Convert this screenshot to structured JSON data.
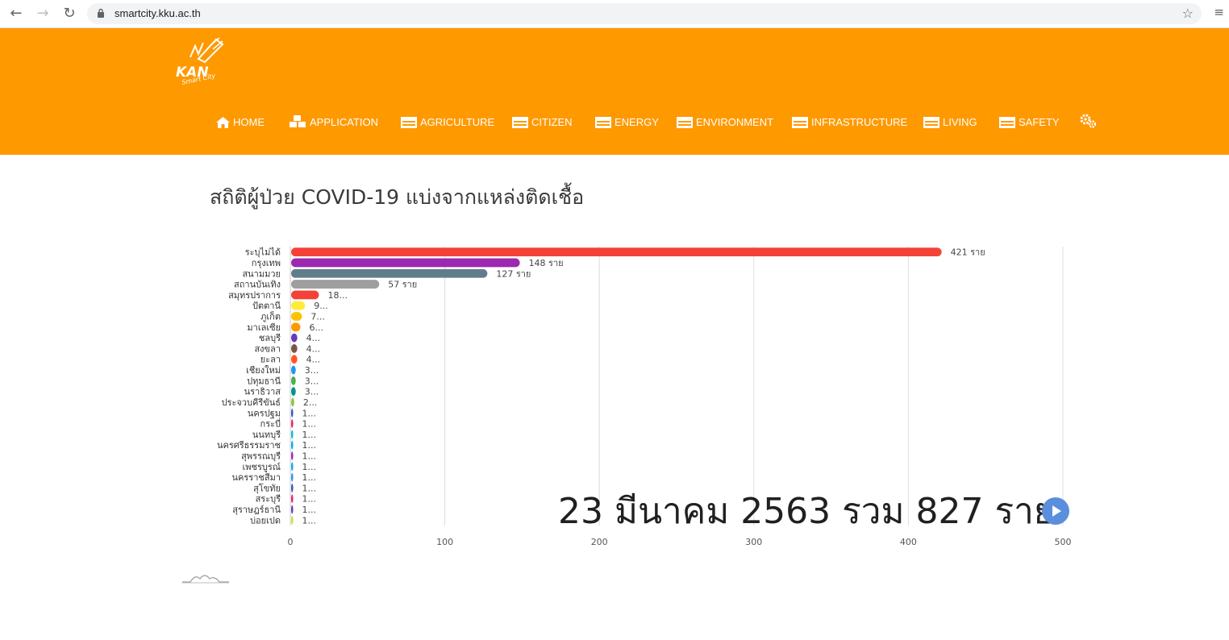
{
  "browser": {
    "url": "smartcity.kku.ac.th"
  },
  "site": {
    "logo_text": "KAN Smart City",
    "nav": [
      {
        "label": "HOME",
        "icon": "home-icon"
      },
      {
        "label": "APPLICATION",
        "icon": "cubes-icon"
      },
      {
        "label": "AGRICULTURE",
        "icon": "table-icon"
      },
      {
        "label": "CITIZEN",
        "icon": "table-icon"
      },
      {
        "label": "ENERGY",
        "icon": "table-icon"
      },
      {
        "label": "ENVIRONMENT",
        "icon": "table-icon"
      },
      {
        "label": "INFRASTRUCTURE",
        "icon": "table-icon"
      },
      {
        "label": "LIVING",
        "icon": "table-icon"
      },
      {
        "label": "SAFETY",
        "icon": "table-icon"
      },
      {
        "label": "",
        "icon": "cogs-icon"
      }
    ],
    "accent_color": "#ff9900"
  },
  "page": {
    "title": "สถิติผู้ป่วย COVID-19 แบ่งจากแหล่งติดเชื้อ"
  },
  "chart_data": {
    "type": "bar",
    "orientation": "horizontal",
    "title": "23 มีนาคม 2563 รวม 827 ราย",
    "xlim": [
      0,
      500
    ],
    "xticks": [
      "0",
      "100",
      "200",
      "300",
      "400",
      "500"
    ],
    "grid": true,
    "categories": [
      "ระบุไม่ได้",
      "กรุงเทพ",
      "สนามมวย",
      "สถานบันเทิง",
      "สมุทรปราการ",
      "ปัตตานี",
      "ภูเก็ต",
      "มาเลเซีย",
      "ชลบุรี",
      "สงขลา",
      "ยะลา",
      "เชียงใหม่",
      "ปทุมธานี",
      "นราธิวาส",
      "ประจวบคีรีขันธ์",
      "นครปฐม",
      "กระบี่",
      "นนทบุรี",
      "นครศรีธรรมราช",
      "สุพรรณบุรี",
      "เพชรบูรณ์",
      "นครราชสีมา",
      "สุโขทัย",
      "สระบุรี",
      "สุราษฎร์ธานี",
      "บ่อยเปด"
    ],
    "values": [
      421,
      148,
      127,
      57,
      18,
      9,
      7,
      6,
      4,
      4,
      4,
      3,
      3,
      3,
      2,
      1,
      1,
      1,
      1,
      1,
      1,
      1,
      1,
      1,
      1,
      1
    ],
    "value_labels": [
      "421 ราย",
      "148 ราย",
      "127 ราย",
      "57 ราย",
      "18...",
      "9...",
      "7...",
      "6...",
      "4...",
      "4...",
      "4...",
      "3...",
      "3...",
      "3...",
      "2...",
      "1...",
      "1...",
      "1...",
      "1...",
      "1...",
      "1...",
      "1...",
      "1...",
      "1...",
      "1...",
      "1..."
    ],
    "colors": [
      "#f44336",
      "#9c27b0",
      "#607d8b",
      "#9e9e9e",
      "#f44336",
      "#ffeb3b",
      "#ffc107",
      "#ff9800",
      "#673ab7",
      "#795548",
      "#ff5722",
      "#2196f3",
      "#4caf50",
      "#009688",
      "#8bc34a",
      "#3f51b5",
      "#e91e63",
      "#00bcd4",
      "#03a9f4",
      "#9c27b0",
      "#03a9f4",
      "#2196f3",
      "#3f51b5",
      "#e91e63",
      "#673ab7",
      "#cddc39"
    ]
  }
}
